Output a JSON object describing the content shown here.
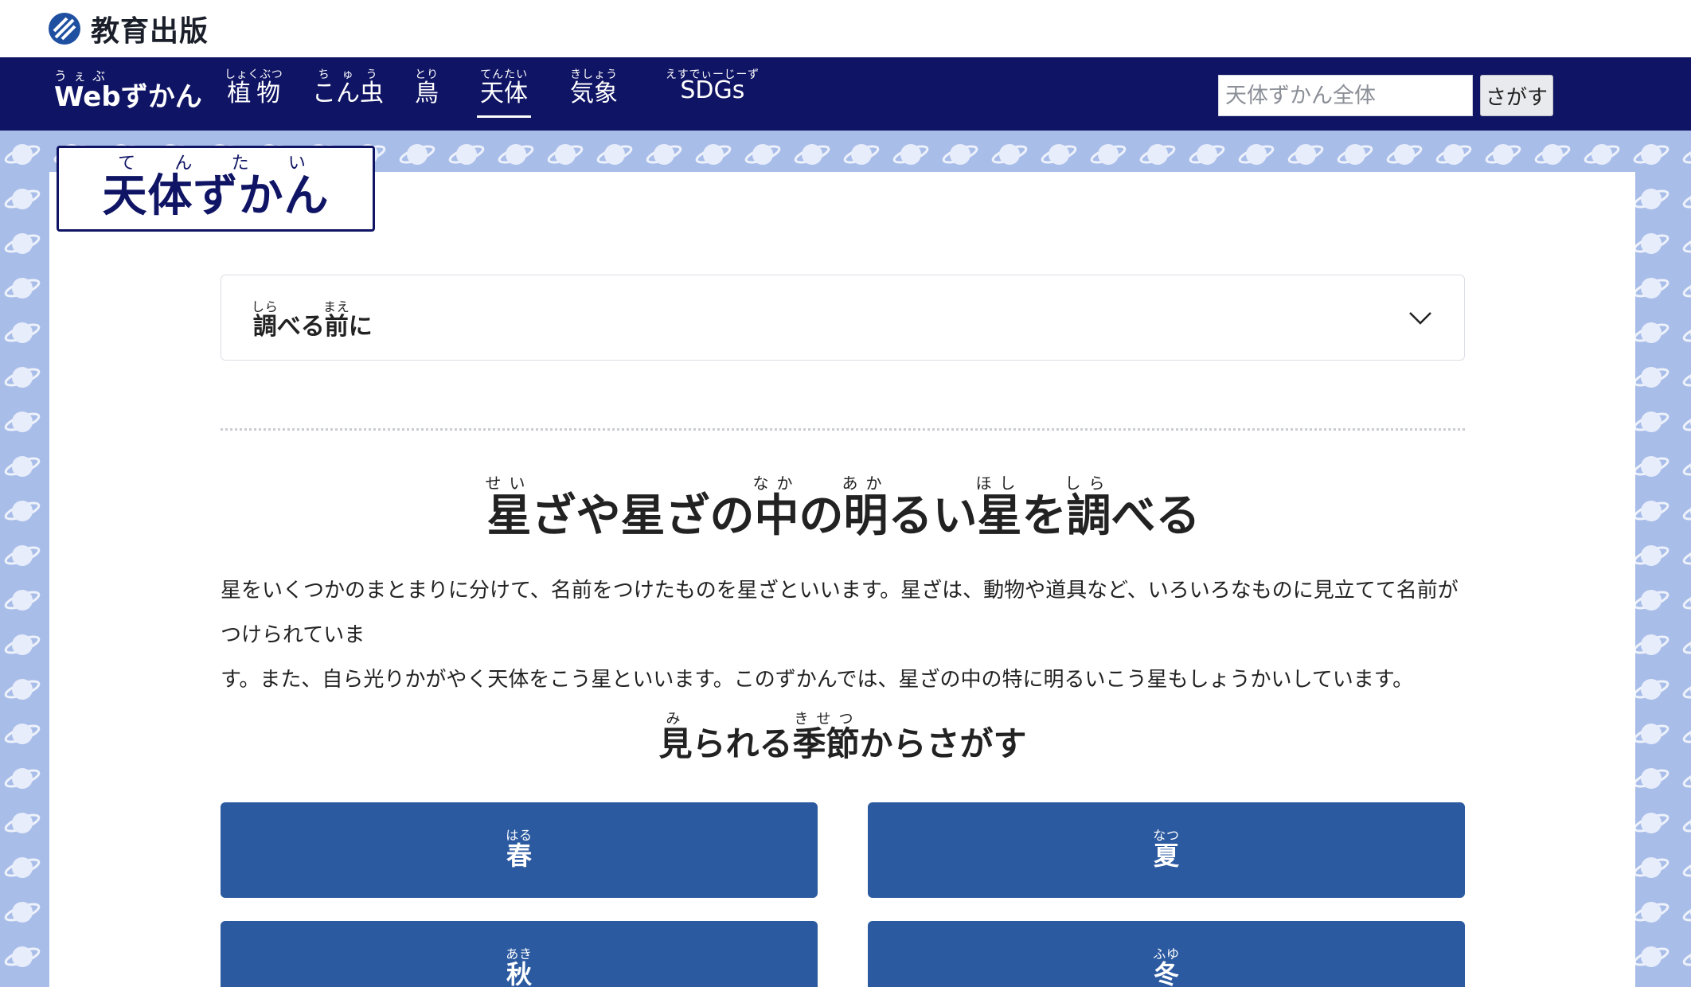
{
  "logo": {
    "text": "教育出版",
    "icon": "logo-icon"
  },
  "nav": {
    "brand": {
      "label": "Webずかん",
      "ruby_text": "うぇぶ"
    },
    "items": [
      {
        "label": "植物",
        "ruby": "しょくぶつ",
        "active": false
      },
      {
        "label": "こん虫",
        "ruby": "ちゅう",
        "active": false
      },
      {
        "label": "鳥",
        "ruby": "とり",
        "active": false
      },
      {
        "label": "天体",
        "ruby": "てんたい",
        "active": true
      },
      {
        "label": "気象",
        "ruby": "きしょう",
        "active": false
      },
      {
        "label": "SDGs",
        "ruby": "えすでぃーじーず",
        "active": false
      }
    ],
    "search_placeholder": "天体ずかん全体",
    "search_value": "",
    "search_button": "さがす"
  },
  "page_title": {
    "text": "天体ずかん",
    "ruby": "てんたい"
  },
  "accordion": {
    "label": "調べる前に",
    "ruby_shira": "しら",
    "ruby_mae": "まえ",
    "icon": "chevron-down-icon"
  },
  "section1": {
    "heading": "星ざや星ざの中の明るい星を調べる",
    "ruby": {
      "sei": "せい",
      "naka": "なか",
      "aka": "あか",
      "hoshi": "ほし",
      "shira": "しら"
    },
    "intro_line1": "星をいくつかのまとまりに分けて、名前をつけたものを星ざといいます。星ざは、動物や道具など、いろいろなものに見立てて名前がつけられていま",
    "intro_line2": "す。また、自ら光りかがやく天体をこう星といいます。このずかんでは、星ざの中の特に明るいこう星もしょうかいしています。"
  },
  "section2": {
    "heading": "見られる季節からさがす",
    "ruby": {
      "mi": "み",
      "kisetsu": "きせつ"
    }
  },
  "seasons": [
    {
      "label": "春",
      "ruby": "はる"
    },
    {
      "label": "夏",
      "ruby": "なつ"
    },
    {
      "label": "秋",
      "ruby": "あき"
    },
    {
      "label": "冬",
      "ruby": "ふゆ"
    }
  ],
  "colors": {
    "nav_bg": "#0f1464",
    "pattern_bg": "#a9bde9",
    "button_blue": "#2c5aa0",
    "title_blue": "#0f1464"
  }
}
